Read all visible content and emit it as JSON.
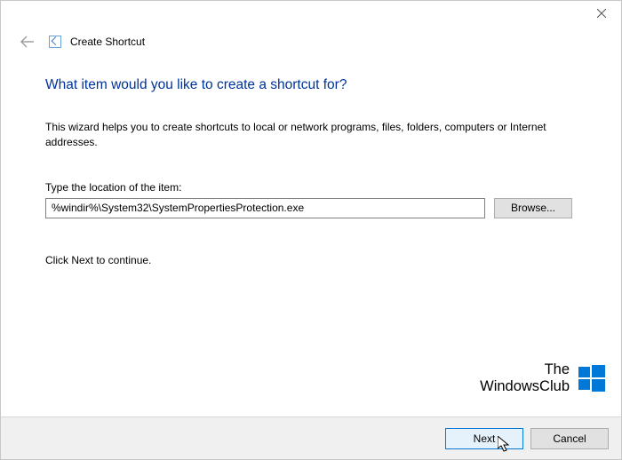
{
  "wizard": {
    "title": "Create Shortcut",
    "heading": "What item would you like to create a shortcut for?",
    "description": "This wizard helps you to create shortcuts to local or network programs, files, folders, computers or Internet addresses.",
    "field_label": "Type the location of the item:",
    "location_value": "%windir%\\System32\\SystemPropertiesProtection.exe",
    "browse_label": "Browse...",
    "continue_text": "Click Next to continue."
  },
  "footer": {
    "next_label": "Next",
    "cancel_label": "Cancel"
  },
  "watermark": {
    "line1": "The",
    "line2": "WindowsClub"
  }
}
